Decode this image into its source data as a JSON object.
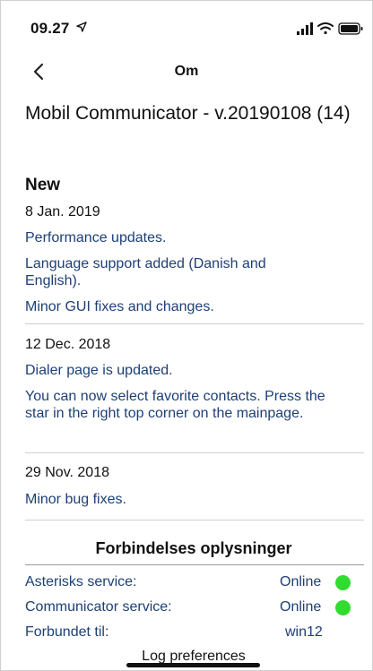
{
  "status_bar": {
    "time": "09.27"
  },
  "nav": {
    "back_icon": "chevron-left-icon",
    "title": "Om"
  },
  "app": {
    "title": "Mobil Communicator - v.20190108 (14)"
  },
  "changelog": {
    "heading": "New",
    "entries": [
      {
        "date": "8 Jan. 2019",
        "items": [
          "Performance updates.",
          "Language support added (Danish and English).",
          "Minor GUI fixes and changes."
        ]
      },
      {
        "date": "12 Dec. 2018",
        "items": [
          "Dialer page is updated.",
          "You can now select favorite contacts. Press the star in the right top corner on the mainpage."
        ]
      },
      {
        "date": "29 Nov. 2018",
        "items": [
          "Minor bug fixes."
        ]
      }
    ]
  },
  "connection": {
    "heading": "Forbindelses oplysninger",
    "rows": [
      {
        "label": "Asterisks service:",
        "value": "Online",
        "status_color": "#2fdc2f"
      },
      {
        "label": "Communicator service:",
        "value": "Online",
        "status_color": "#2fdc2f"
      },
      {
        "label": "Forbundet til:",
        "value": "win12"
      }
    ]
  },
  "footer": {
    "log_link": "Log preferences"
  },
  "colors": {
    "link_text": "#1d3f77",
    "online": "#2fdc2f"
  }
}
